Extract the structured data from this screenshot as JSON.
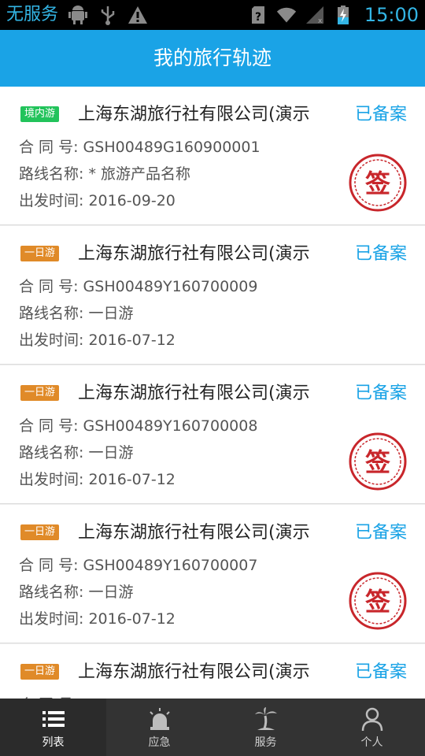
{
  "statusbar": {
    "carrier": "无服务",
    "time": "15:00",
    "icons": [
      "android-icon",
      "usb-icon",
      "warning-icon",
      "sim-unknown-icon",
      "wifi-icon",
      "signal-icon",
      "battery-charging-icon"
    ]
  },
  "header": {
    "title": "我的旅行轨迹"
  },
  "labels": {
    "contract": "合 同 号:",
    "route": "路线名称:",
    "departure": "出发时间:",
    "seal": "签"
  },
  "colors": {
    "accent": "#1aa3e6",
    "badge_domestic": "#22c35b",
    "badge_day": "#e08a28",
    "seal": "#c8262b"
  },
  "trips": [
    {
      "badge": "境内游",
      "badge_color": "green",
      "company": "上海东湖旅行社有限公司(演示",
      "status": "已备案",
      "contract": "GSH00489G160900001",
      "route": "* 旅游产品名称",
      "departure": "2016-09-20",
      "signed": true
    },
    {
      "badge": "一日游",
      "badge_color": "orange",
      "company": "上海东湖旅行社有限公司(演示",
      "status": "已备案",
      "contract": "GSH00489Y160700009",
      "route": "一日游",
      "departure": "2016-07-12",
      "signed": false
    },
    {
      "badge": "一日游",
      "badge_color": "orange",
      "company": "上海东湖旅行社有限公司(演示",
      "status": "已备案",
      "contract": "GSH00489Y160700008",
      "route": "一日游",
      "departure": "2016-07-12",
      "signed": true
    },
    {
      "badge": "一日游",
      "badge_color": "orange",
      "company": "上海东湖旅行社有限公司(演示",
      "status": "已备案",
      "contract": "GSH00489Y160700007",
      "route": "一日游",
      "departure": "2016-07-12",
      "signed": true
    },
    {
      "badge": "一日游",
      "badge_color": "orange",
      "company": "上海东湖旅行社有限公司(演示",
      "status": "已备案",
      "contract": "",
      "route": "",
      "departure": "",
      "signed": false
    }
  ],
  "nav": [
    {
      "label": "列表",
      "icon": "list-icon",
      "active": true
    },
    {
      "label": "应急",
      "icon": "alarm-icon",
      "active": false
    },
    {
      "label": "服务",
      "icon": "palm-tree-icon",
      "active": false
    },
    {
      "label": "个人",
      "icon": "person-icon",
      "active": false
    }
  ]
}
